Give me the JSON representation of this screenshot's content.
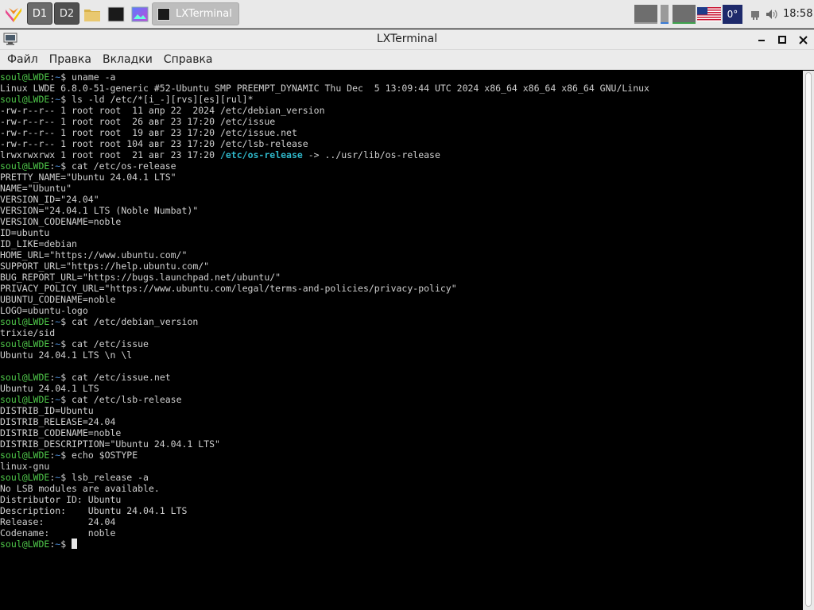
{
  "taskbar": {
    "desktops": [
      "D1",
      "D2"
    ],
    "active_task": "LXTerminal",
    "temperature": "0°",
    "clock": "18:58",
    "icons": [
      "app-menu-icon",
      "file-manager-icon",
      "terminal-icon",
      "image-viewer-icon",
      "us-flag-icon",
      "network-icon",
      "volume-icon"
    ]
  },
  "window": {
    "title": "LXTerminal",
    "menu": [
      "Файл",
      "Правка",
      "Вкладки",
      "Справка"
    ]
  },
  "terminal": {
    "user": "soul@LWDE",
    "cwd": "~",
    "lines": [
      {
        "t": "p",
        "cmd": "uname -a"
      },
      {
        "t": "o",
        "text": "Linux LWDE 6.8.0-51-generic #52-Ubuntu SMP PREEMPT_DYNAMIC Thu Dec  5 13:09:44 UTC 2024 x86_64 x86_64 x86_64 GNU/Linux"
      },
      {
        "t": "p",
        "cmd": "ls -ld /etc/*[i_-][rvs][es][rul]*"
      },
      {
        "t": "o",
        "text": "-rw-r--r-- 1 root root  11 апр 22  2024 /etc/debian_version"
      },
      {
        "t": "o",
        "text": "-rw-r--r-- 1 root root  26 авг 23 17:20 /etc/issue"
      },
      {
        "t": "o",
        "text": "-rw-r--r-- 1 root root  19 авг 23 17:20 /etc/issue.net"
      },
      {
        "t": "o",
        "text": "-rw-r--r-- 1 root root 104 авг 23 17:20 /etc/lsb-release"
      },
      {
        "t": "l",
        "text": "lrwxrwxrwx 1 root root  21 авг 23 17:20 ",
        "link": "/etc/os-release",
        "rest": " -> ../usr/lib/os-release"
      },
      {
        "t": "p",
        "cmd": "cat /etc/os-release"
      },
      {
        "t": "o",
        "text": "PRETTY_NAME=\"Ubuntu 24.04.1 LTS\""
      },
      {
        "t": "o",
        "text": "NAME=\"Ubuntu\""
      },
      {
        "t": "o",
        "text": "VERSION_ID=\"24.04\""
      },
      {
        "t": "o",
        "text": "VERSION=\"24.04.1 LTS (Noble Numbat)\""
      },
      {
        "t": "o",
        "text": "VERSION_CODENAME=noble"
      },
      {
        "t": "o",
        "text": "ID=ubuntu"
      },
      {
        "t": "o",
        "text": "ID_LIKE=debian"
      },
      {
        "t": "o",
        "text": "HOME_URL=\"https://www.ubuntu.com/\""
      },
      {
        "t": "o",
        "text": "SUPPORT_URL=\"https://help.ubuntu.com/\""
      },
      {
        "t": "o",
        "text": "BUG_REPORT_URL=\"https://bugs.launchpad.net/ubuntu/\""
      },
      {
        "t": "o",
        "text": "PRIVACY_POLICY_URL=\"https://www.ubuntu.com/legal/terms-and-policies/privacy-policy\""
      },
      {
        "t": "o",
        "text": "UBUNTU_CODENAME=noble"
      },
      {
        "t": "o",
        "text": "LOGO=ubuntu-logo"
      },
      {
        "t": "p",
        "cmd": "cat /etc/debian_version"
      },
      {
        "t": "o",
        "text": "trixie/sid"
      },
      {
        "t": "p",
        "cmd": "cat /etc/issue"
      },
      {
        "t": "o",
        "text": "Ubuntu 24.04.1 LTS \\n \\l"
      },
      {
        "t": "o",
        "text": ""
      },
      {
        "t": "p",
        "cmd": "cat /etc/issue.net"
      },
      {
        "t": "o",
        "text": "Ubuntu 24.04.1 LTS"
      },
      {
        "t": "p",
        "cmd": "cat /etc/lsb-release"
      },
      {
        "t": "o",
        "text": "DISTRIB_ID=Ubuntu"
      },
      {
        "t": "o",
        "text": "DISTRIB_RELEASE=24.04"
      },
      {
        "t": "o",
        "text": "DISTRIB_CODENAME=noble"
      },
      {
        "t": "o",
        "text": "DISTRIB_DESCRIPTION=\"Ubuntu 24.04.1 LTS\""
      },
      {
        "t": "p",
        "cmd": "echo $OSTYPE"
      },
      {
        "t": "o",
        "text": "linux-gnu"
      },
      {
        "t": "p",
        "cmd": "lsb_release -a"
      },
      {
        "t": "o",
        "text": "No LSB modules are available."
      },
      {
        "t": "o",
        "text": "Distributor ID:\tUbuntu"
      },
      {
        "t": "o",
        "text": "Description:\tUbuntu 24.04.1 LTS"
      },
      {
        "t": "o",
        "text": "Release:\t24.04"
      },
      {
        "t": "o",
        "text": "Codename:\tnoble"
      },
      {
        "t": "c",
        "cmd": ""
      }
    ]
  },
  "colors": {
    "prompt_user": "#4fc94a",
    "prompt_path": "#4a8bd6",
    "symlink": "#2fb7c9",
    "output": "#d0d0d0",
    "background": "#000000"
  }
}
